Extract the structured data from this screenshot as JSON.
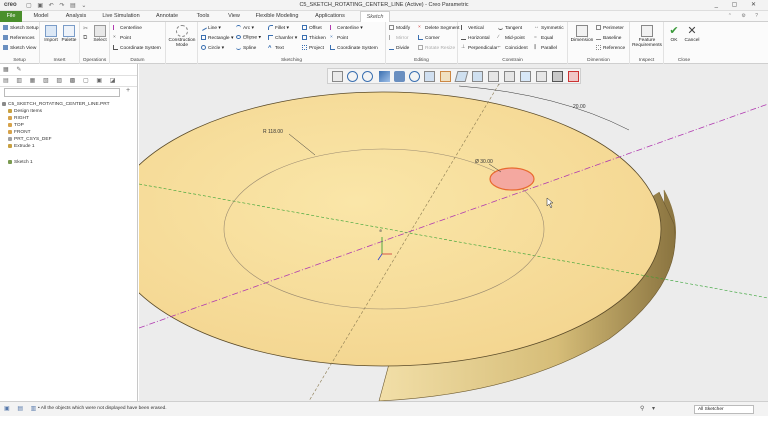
{
  "titlebar": {
    "logo": "creo",
    "title": "C5_SKETCH_ROTATING_CENTER_LINE (Active) - Creo Parametric"
  },
  "tabs": [
    {
      "label": "File"
    },
    {
      "label": "Model"
    },
    {
      "label": "Analysis"
    },
    {
      "label": "Live Simulation"
    },
    {
      "label": "Annotate"
    },
    {
      "label": "Tools"
    },
    {
      "label": "View"
    },
    {
      "label": "Flexible Modeling"
    },
    {
      "label": "Applications"
    },
    {
      "label": "Sketch"
    }
  ],
  "ribbon": {
    "setup": {
      "items": [
        "Sketch Setup",
        "References",
        "Sketch View"
      ],
      "label": "Setup"
    },
    "insert": {
      "items": [
        "Import",
        "Palette"
      ],
      "label": "Insert"
    },
    "operations": {
      "select": "Select",
      "label": "Operations"
    },
    "datum": {
      "items": [
        "Centerline",
        "Point",
        "Coordinate System"
      ],
      "label": "Datum"
    },
    "construction": {
      "label": "Construction Mode"
    },
    "sketching": {
      "items": [
        "Line",
        "Arc",
        "Fillet",
        "Centerline",
        "Rectangle",
        "Ellipse",
        "Chamfer",
        "Point",
        "Circle",
        "Spline",
        "Text",
        "Offset",
        "Thicken",
        "Project",
        "Coordinate System"
      ],
      "label": "Sketching"
    },
    "editing": {
      "items": [
        "Modify",
        "Delete Segment",
        "Mirror",
        "Corner",
        "Divide",
        "Rotate Resize"
      ],
      "label": "Editing"
    },
    "constrain": {
      "items": [
        "Vertical",
        "Tangent",
        "Symmetric",
        "Horizontal",
        "Mid-point",
        "Equal",
        "Perpendicular",
        "Coincident",
        "Parallel"
      ],
      "label": "Constrain"
    },
    "dimension": {
      "items": [
        "Dimension",
        "Perimeter",
        "Baseline",
        "Reference"
      ],
      "label": "Dimension"
    },
    "inspect": {
      "items": [
        "Feature Requirements"
      ],
      "label": "Inspect"
    },
    "close": {
      "items": [
        "OK",
        "Cancel"
      ],
      "label": "Close"
    }
  },
  "tree": [
    {
      "label": "C5_SKETCH_ROTATING_CENTER_LINE.PRT",
      "color": "#8a8a8a"
    },
    {
      "label": "Design Items",
      "color": "#c8a040"
    },
    {
      "label": "RIGHT",
      "color": "#d6a24a"
    },
    {
      "label": "TOP",
      "color": "#d6a24a"
    },
    {
      "label": "FRONT",
      "color": "#d6a24a"
    },
    {
      "label": "PRT_CSYS_DEF",
      "color": "#a0a0a0"
    },
    {
      "label": "Extrude 1",
      "color": "#c8a040"
    },
    {
      "label": "Sketch 1",
      "color": "#7a9a50"
    }
  ],
  "dimensions": {
    "radius": "R 118.00",
    "diameter": "Ø 30.00",
    "angle": "20.00"
  },
  "status": {
    "message": "All the objects which were not displayed have been erased.",
    "filter": "All Sketcher"
  },
  "colors": {
    "part_top": "#f8dfa0",
    "part_side": "#a08a50",
    "file_tab": "#4a8f2c",
    "centerline": "#b03ab0",
    "highlight": "#f0a090"
  }
}
